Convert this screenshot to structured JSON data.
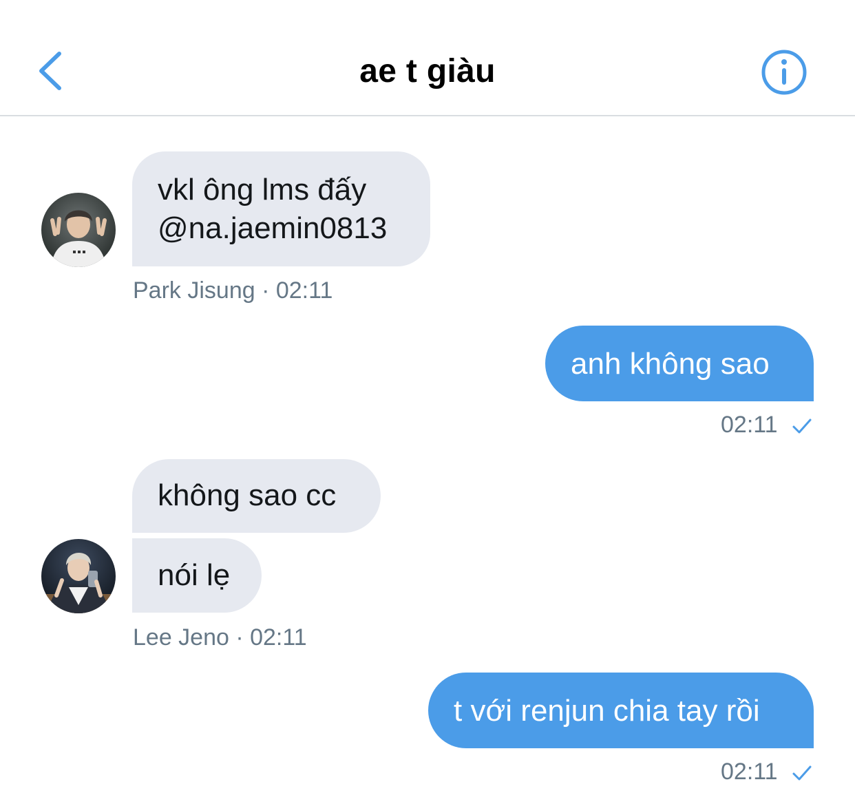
{
  "header": {
    "title": "ae t giàu",
    "back_icon": "chevron-left-icon",
    "info_icon": "info-icon",
    "accent": "#4b9ce8"
  },
  "messages": [
    {
      "direction": "incoming",
      "sender": "Park Jisung",
      "text": "vkl ông lms đấy\n@na.jaemin0813",
      "meta": "Park Jisung · 02:11"
    },
    {
      "direction": "outgoing",
      "text": "anh không sao",
      "meta": "02:11",
      "status_icon": "checkmark-icon"
    },
    {
      "direction": "incoming",
      "sender": "Lee Jeno",
      "text": "không sao cc"
    },
    {
      "direction": "incoming",
      "sender": "Lee Jeno",
      "text": "nói lẹ",
      "meta": "Lee Jeno · 02:11"
    },
    {
      "direction": "outgoing",
      "text": "t với renjun chia tay rồi",
      "meta": "02:11",
      "status_icon": "checkmark-icon"
    }
  ],
  "colors": {
    "incoming_bubble": "#e6e9f0",
    "outgoing_bubble": "#4b9ce8",
    "meta_text": "#657786"
  }
}
